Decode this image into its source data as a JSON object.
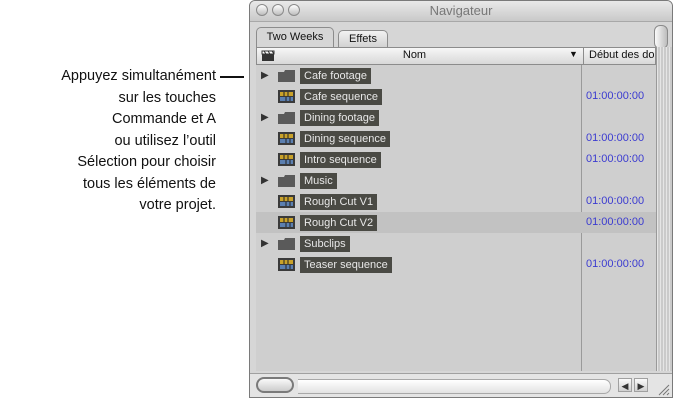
{
  "callout": {
    "lines": [
      "Appuyez simultanément",
      "sur les touches",
      "Commande et A",
      "ou utilisez l’outil",
      "Sélection pour choisir",
      "tous les éléments de",
      "votre projet."
    ]
  },
  "window": {
    "title": "Navigateur",
    "tabs": [
      "Two Weeks",
      "Effets"
    ],
    "columns": {
      "name": "Nom",
      "start": "Début des do"
    },
    "rows": [
      {
        "type": "folder",
        "name": "Cafe footage",
        "tc": ""
      },
      {
        "type": "sequence",
        "name": "Cafe sequence",
        "tc": "01:00:00:00"
      },
      {
        "type": "folder",
        "name": "Dining footage",
        "tc": ""
      },
      {
        "type": "sequence",
        "name": "Dining sequence",
        "tc": "01:00:00:00"
      },
      {
        "type": "sequence",
        "name": "Intro sequence",
        "tc": "01:00:00:00"
      },
      {
        "type": "folder",
        "name": "Music",
        "tc": ""
      },
      {
        "type": "sequence",
        "name": "Rough Cut V1",
        "tc": "01:00:00:00"
      },
      {
        "type": "sequence",
        "name": "Rough Cut V2",
        "tc": "01:00:00:00"
      },
      {
        "type": "folder",
        "name": "Subclips",
        "tc": ""
      },
      {
        "type": "sequence",
        "name": "Teaser sequence",
        "tc": "01:00:00:00"
      }
    ],
    "colors": {
      "label_bg": "#4a4a44",
      "timecode": "#3b3bd0",
      "list_bg": "#cfcfcf"
    }
  }
}
